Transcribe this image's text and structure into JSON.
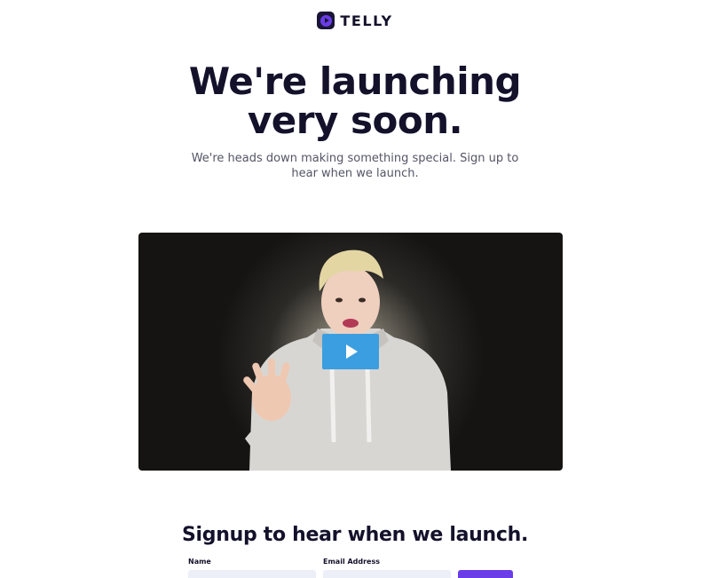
{
  "brand": {
    "name": "TELLY",
    "logo_icon": "play-circle-icon",
    "accent": "#6a3de8",
    "dark": "#1a1536"
  },
  "hero": {
    "title_line1": "We're launching",
    "title_line2": "very soon.",
    "subtitle": "We're heads down making something special. Sign up to hear when we launch."
  },
  "video": {
    "play_icon": "play-icon",
    "play_color": "#3b9ee0"
  },
  "signup": {
    "title": "Signup to hear when we launch.",
    "name_label": "Name",
    "email_label": "Email Address",
    "name_value": "",
    "email_value": "",
    "submit_label": ""
  }
}
